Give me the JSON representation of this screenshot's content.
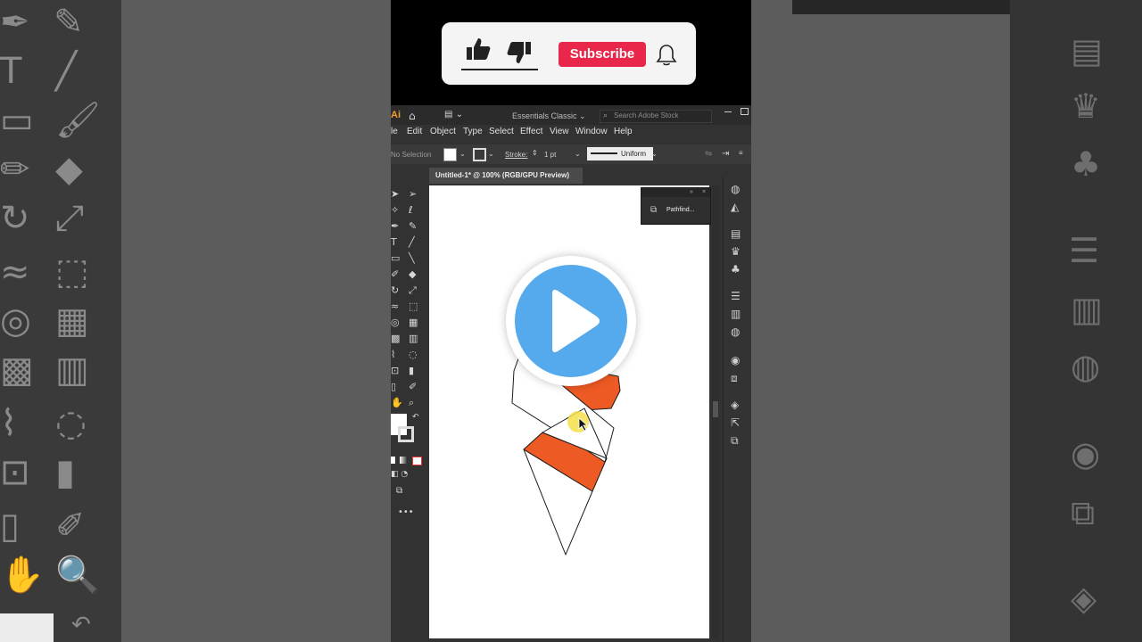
{
  "subscribe_card": {
    "like_icon": "thumbs-up-icon",
    "dislike_icon": "thumbs-down-icon",
    "subscribe_label": "Subscribe",
    "bell_icon": "bell-icon",
    "accent": "#e8274b"
  },
  "app": {
    "logo": "Ai",
    "workspace": "Essentials Classic",
    "search_placeholder": "Search Adobe Stock",
    "menu": [
      "le",
      "Edit",
      "Object",
      "Type",
      "Select",
      "Effect",
      "View",
      "Window",
      "Help"
    ],
    "control_bar": {
      "selection": "No Selection",
      "stroke_label": "Stroke:",
      "stroke_value": "1 pt",
      "profile": "Uniform"
    },
    "document_tab": "Untitled-1* @ 100% (RGB/GPU Preview)",
    "panel": {
      "title": "Pathfind..."
    }
  },
  "artwork": {
    "orange": "#ee5a24",
    "outline": "#1a1a1a"
  },
  "overlay": {
    "play_icon": "play-icon",
    "play_color": "#55aaee",
    "cursor_highlight": "#f5e14a"
  }
}
